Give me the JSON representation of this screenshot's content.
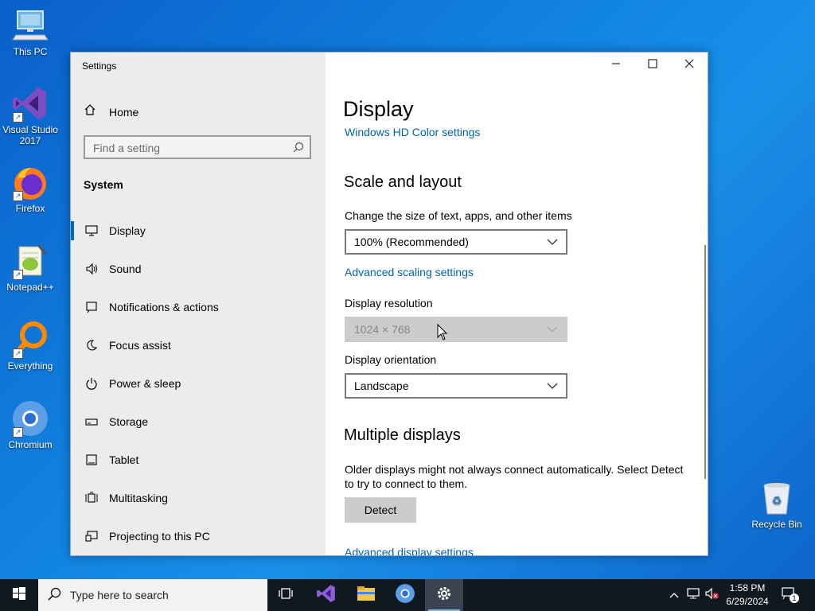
{
  "desktop": {
    "icons": [
      {
        "label": "This PC"
      },
      {
        "label": "Visual Studio 2017"
      },
      {
        "label": "Firefox"
      },
      {
        "label": "Notepad++"
      },
      {
        "label": "Everything"
      },
      {
        "label": "Chromium"
      },
      {
        "label": "Recycle Bin"
      }
    ]
  },
  "window": {
    "title": "Settings",
    "controls": [
      "minimize-icon",
      "maximize-icon",
      "close-icon"
    ]
  },
  "sidebar": {
    "home_label": "Home",
    "search_placeholder": "Find a setting",
    "section": "System",
    "items": [
      {
        "label": "Display",
        "icon": "monitor-icon",
        "active": true
      },
      {
        "label": "Sound",
        "icon": "speaker-icon"
      },
      {
        "label": "Notifications & actions",
        "icon": "notification-icon"
      },
      {
        "label": "Focus assist",
        "icon": "moon-icon"
      },
      {
        "label": "Power & sleep",
        "icon": "power-icon"
      },
      {
        "label": "Storage",
        "icon": "storage-icon"
      },
      {
        "label": "Tablet",
        "icon": "tablet-icon"
      },
      {
        "label": "Multitasking",
        "icon": "multitasking-icon"
      },
      {
        "label": "Projecting to this PC",
        "icon": "projecting-icon"
      }
    ]
  },
  "main": {
    "title": "Display",
    "hd_color_link": "Windows HD Color settings",
    "scale_heading": "Scale and layout",
    "scale_label": "Change the size of text, apps, and other items",
    "scale_value": "100% (Recommended)",
    "advanced_scaling_link": "Advanced scaling settings",
    "resolution_label": "Display resolution",
    "resolution_value": "1024 × 768",
    "orientation_label": "Display orientation",
    "orientation_value": "Landscape",
    "multiple_heading": "Multiple displays",
    "multiple_text": "Older displays might not always connect automatically. Select Detect to try to connect to them.",
    "detect_button": "Detect",
    "advanced_display_link": "Advanced display settings"
  },
  "taskbar": {
    "search_placeholder": "Type here to search",
    "time": "1:58 PM",
    "date": "6/29/2024",
    "notification_count": "1",
    "colors": {
      "background": "#101820",
      "accent": "#76b9ed"
    }
  }
}
